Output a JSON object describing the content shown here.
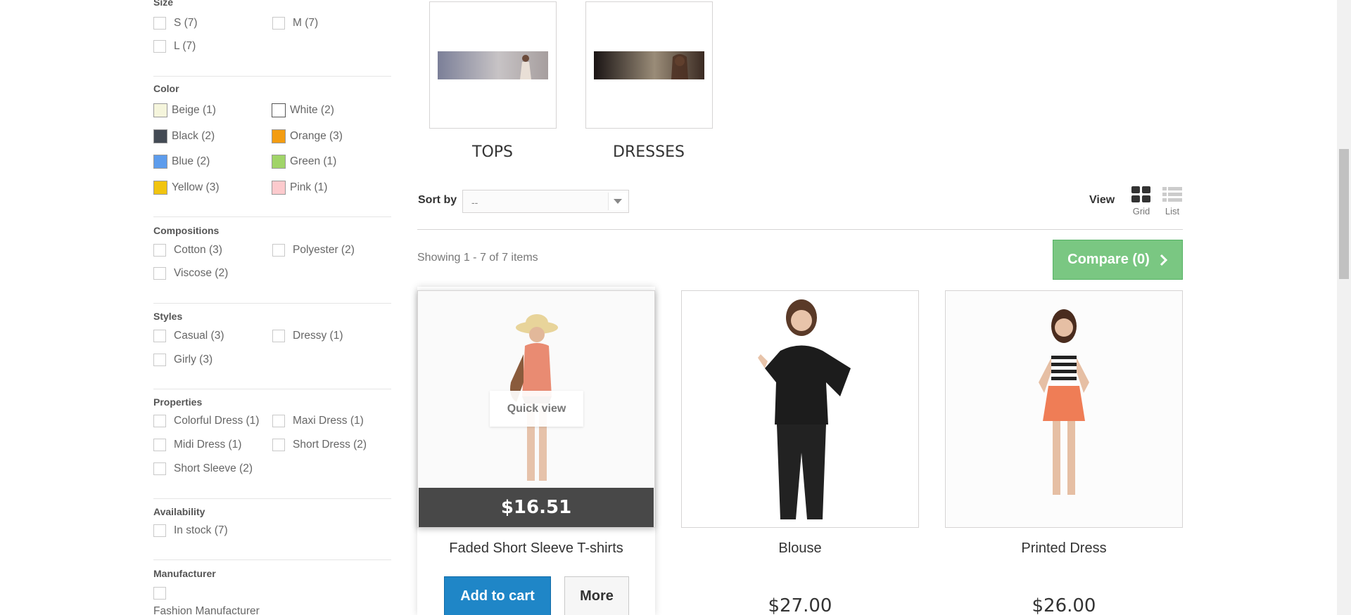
{
  "filters": {
    "size": {
      "title": "Size",
      "items": [
        "S (7)",
        "M (7)",
        "L (7)"
      ]
    },
    "color": {
      "title": "Color",
      "items": [
        {
          "label": "Beige (1)",
          "swatch": "#f5f5dc"
        },
        {
          "label": "White (2)",
          "swatch": "#ffffff"
        },
        {
          "label": "Black (2)",
          "swatch": "#434a54"
        },
        {
          "label": "Orange (3)",
          "swatch": "#f39c11"
        },
        {
          "label": "Blue (2)",
          "swatch": "#5d9cec"
        },
        {
          "label": "Green (1)",
          "swatch": "#a0d468"
        },
        {
          "label": "Yellow (3)",
          "swatch": "#f1c40f"
        },
        {
          "label": "Pink (1)",
          "swatch": "#fccacd"
        }
      ]
    },
    "compositions": {
      "title": "Compositions",
      "items": [
        "Cotton (3)",
        "Polyester (2)",
        "Viscose (2)"
      ]
    },
    "styles": {
      "title": "Styles",
      "items": [
        "Casual (3)",
        "Dressy (1)",
        "Girly (3)"
      ]
    },
    "properties": {
      "title": "Properties",
      "items": [
        "Colorful Dress (1)",
        "Maxi Dress (1)",
        "Midi Dress (1)",
        "Short Dress (2)",
        "Short Sleeve (2)"
      ]
    },
    "availability": {
      "title": "Availability",
      "items": [
        "In stock (7)"
      ]
    },
    "manufacturer": {
      "title": "Manufacturer",
      "items": [
        "Fashion Manufacturer"
      ]
    }
  },
  "subcategories": [
    "TOPS",
    "DRESSES"
  ],
  "toolbar": {
    "sort_label": "Sort by",
    "sort_value": "--",
    "view_label": "View",
    "view_grid": "Grid",
    "view_list": "List"
  },
  "showing": "Showing 1 - 7 of 7 items",
  "compare_label": "Compare (0)",
  "products": [
    {
      "name": "Faded Short Sleeve T-shirts",
      "price": "$16.51",
      "quick_view": "Quick view",
      "add_to_cart": "Add to cart",
      "more": "More"
    },
    {
      "name": "Blouse",
      "price": "$27.00"
    },
    {
      "name": "Printed Dress",
      "price": "$26.00"
    }
  ],
  "colors": {
    "accent_blue": "#1f86c7",
    "compare_green": "#7ac782",
    "price_bar": "#484848"
  }
}
